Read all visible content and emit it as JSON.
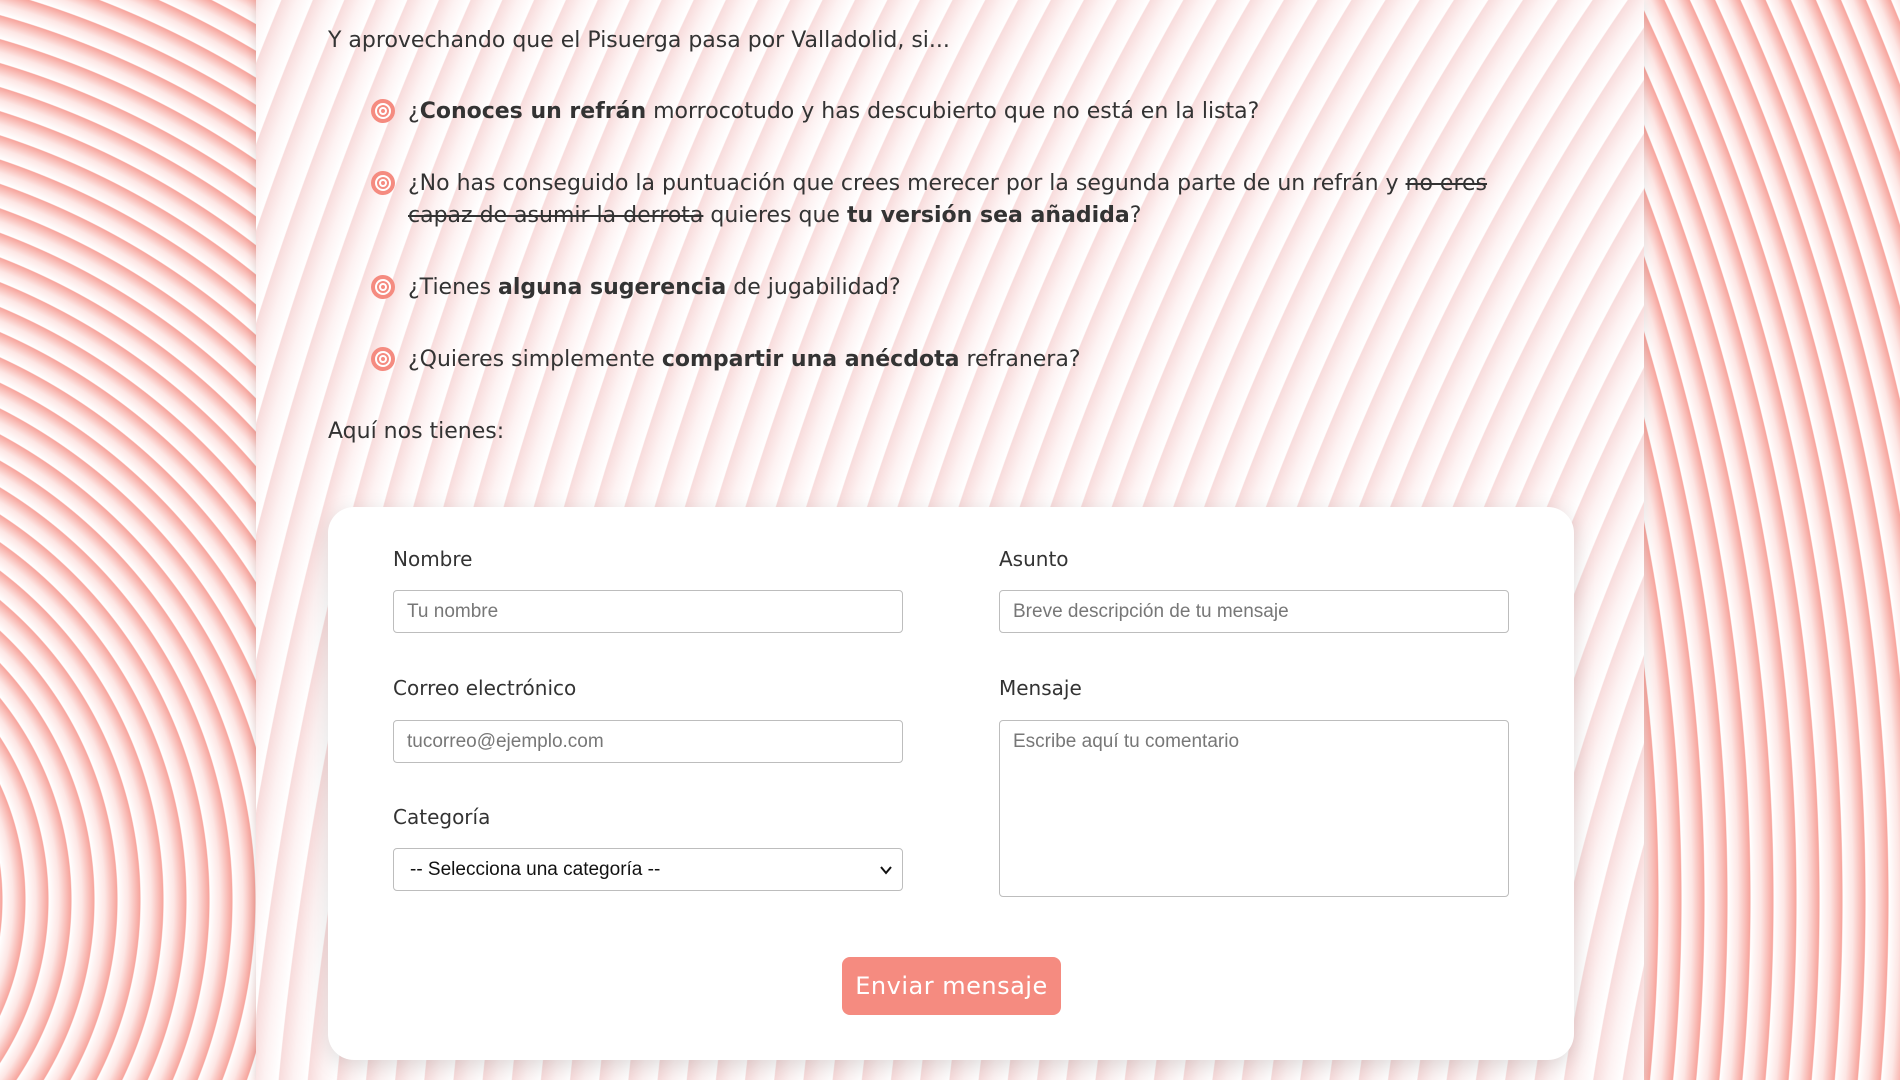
{
  "intro": "Y aprovechando que el Pisuerga pasa por Valladolid, si...",
  "questions": [
    {
      "p1": "¿",
      "b1": "Conoces un refrán",
      "p2": " morrocotudo y has descubierto que no está en la lista?"
    },
    {
      "p1": "¿No has conseguido la puntuación que crees merecer por la segunda parte de un refrán y ",
      "strike": "no eres capaz de asumir la derrota",
      "p2": " quieres que ",
      "b1": "tu versión sea añadida",
      "p3": "?"
    },
    {
      "p1": "¿Tienes ",
      "b1": "alguna sugerencia",
      "p2": " de jugabilidad?"
    },
    {
      "p1": "¿Quieres simplemente ",
      "b1": "compartir una anécdota",
      "p2": " refranera?"
    }
  ],
  "after": "Aquí nos tienes:",
  "form": {
    "name_label": "Nombre",
    "name_placeholder": "Tu nombre",
    "email_label": "Correo electrónico",
    "email_placeholder": "tucorreo@ejemplo.com",
    "category_label": "Categoría",
    "category_selected": "-- Selecciona una categoría --",
    "subject_label": "Asunto",
    "subject_placeholder": "Breve descripción de tu mensaje",
    "message_label": "Mensaje",
    "message_placeholder": "Escribe aquí tu comentario",
    "submit_label": "Enviar mensaje"
  },
  "colors": {
    "accent": "#f58b80",
    "bullet": "#f58b80"
  },
  "icons": {
    "bullet": "swirl-bullet-icon",
    "select": "chevron-down-icon"
  }
}
